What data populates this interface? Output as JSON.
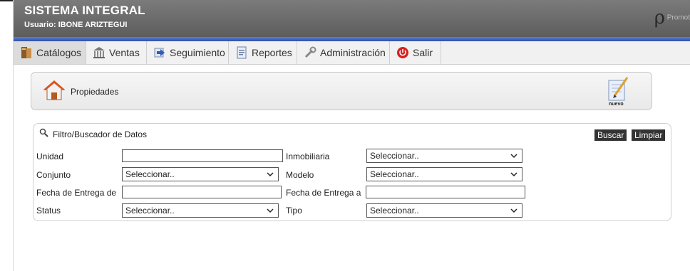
{
  "header": {
    "title": "SISTEMA INTEGRAL",
    "user_label": "Usuario:",
    "user_name": "IBONE ARIZTEGUI",
    "logo_text": "Promot"
  },
  "menu": {
    "items": [
      {
        "label": "Catálogos",
        "icon": "book-icon"
      },
      {
        "label": "Ventas",
        "icon": "bank-icon"
      },
      {
        "label": "Seguimiento",
        "icon": "arrow-right-icon"
      },
      {
        "label": "Reportes",
        "icon": "report-icon"
      },
      {
        "label": "Administración",
        "icon": "wrench-icon"
      },
      {
        "label": "Salir",
        "icon": "power-icon"
      }
    ]
  },
  "section": {
    "title": "Propiedades",
    "new_label": "nuevo"
  },
  "filter": {
    "title": "Filtro/Buscador de Datos",
    "search_button": "Buscar",
    "clear_button": "Limpiar",
    "fields": {
      "unidad": {
        "label": "Unidad",
        "value": ""
      },
      "inmobiliaria": {
        "label": "Inmobiliaria",
        "value": "Seleccionar.."
      },
      "conjunto": {
        "label": "Conjunto",
        "value": "Seleccionar.."
      },
      "modelo": {
        "label": "Modelo",
        "value": "Seleccionar.."
      },
      "fecha_de": {
        "label": "Fecha de Entrega de",
        "value": ""
      },
      "fecha_a": {
        "label": "Fecha de Entrega a",
        "value": ""
      },
      "status": {
        "label": "Status",
        "value": "Seleccionar.."
      },
      "tipo": {
        "label": "Tipo",
        "value": "Seleccionar.."
      }
    }
  },
  "colors": {
    "header_gray": "#6a6a6a",
    "accent_blue": "#3f5fb8",
    "button_dark": "#333333"
  }
}
